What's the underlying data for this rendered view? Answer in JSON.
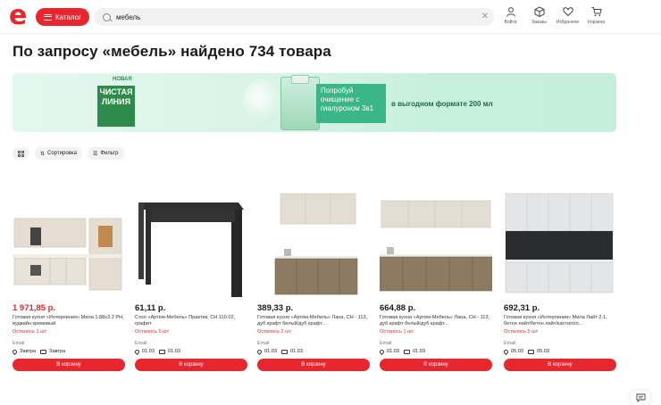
{
  "header": {
    "logo_text": "e",
    "catalog_label": "Каталог",
    "search_value": "мебель",
    "nav": [
      {
        "label": "Войти",
        "icon": "user-icon"
      },
      {
        "label": "Заказы",
        "icon": "box-icon"
      },
      {
        "label": "Избранное",
        "icon": "heart-icon"
      },
      {
        "label": "Корзина",
        "icon": "cart-icon"
      }
    ]
  },
  "page_title": "По запросу «мебель» найдено 734 товара",
  "banner": {
    "new_label": "НОВАЯ",
    "brand_line1": "ЧИСТАЯ",
    "brand_line2": "ЛИНИЯ",
    "promo_text": "Попробуй очищение с гиалуроном 3в1",
    "promo_text2": "в выгодном формате 200 мл"
  },
  "toolbar": {
    "sort_label": "Сортировка",
    "filter_label": "Фильтр"
  },
  "products": [
    {
      "price": "1 971,85 р.",
      "price_red": true,
      "name": "Готовая кухня «Интерлиния» Мила 1.88х3.2 РН, вудвайн кремовый",
      "stock": "Осталось 1 шт",
      "seller": "Email",
      "delivery_pickup": "Завтра",
      "delivery_courier": "Завтра",
      "cart_label": "В корзину"
    },
    {
      "price": "61,11 р.",
      "price_red": false,
      "name": "Стол «Артём-Мебель» Практик, СН 110.02, графит",
      "stock": "Осталось 5 шт",
      "seller": "Email",
      "delivery_pickup": "01.03",
      "delivery_courier": "01.03",
      "cart_label": "В корзину"
    },
    {
      "price": "389,33 р.",
      "price_red": false,
      "name": "Готовая кухня «Артём-Мебель» Лана, СН - 113, дуб крафт белый/дуб крафт...",
      "stock": "Осталось 2 шт",
      "seller": "Email",
      "delivery_pickup": "01.03",
      "delivery_courier": "01.03",
      "cart_label": "В корзину"
    },
    {
      "price": "664,88 р.",
      "price_red": false,
      "name": "Готовая кухня «Артём-Мебель» Лана, СН - 113, дуб крафт белый/дуб крафт...",
      "stock": "Осталось 1 шт",
      "seller": "Email",
      "delivery_pickup": "01.03",
      "delivery_courier": "01.03",
      "cart_label": "В корзину"
    },
    {
      "price": "692,31 р.",
      "price_red": false,
      "name": "Готовая кухня «Интерлиния» Мила Лайт 2.1, бетон лайт/бетон лайт/кастилло...",
      "stock": "Осталось 5 шт",
      "seller": "Email",
      "delivery_pickup": "05.03",
      "delivery_courier": "05.03",
      "cart_label": "В корзину"
    }
  ],
  "colors": {
    "accent": "#e8262e",
    "banner_green": "#2e8b4a"
  }
}
